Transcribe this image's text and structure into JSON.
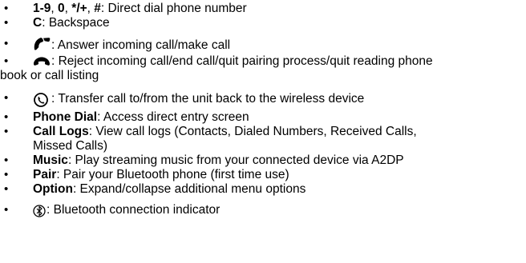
{
  "bullet_char": "•",
  "items": [
    {
      "bold": "1-9",
      "sep1": ", ",
      "bold2": "0",
      "sep2": ", ",
      "bold3": "*/+",
      "sep3": ", ",
      "bold4": "#",
      "text": ": Direct dial phone number"
    },
    {
      "bold": "C",
      "text": ": Backspace"
    },
    {
      "icon": "phone-answer-icon",
      "text": ": Answer incoming call/make call"
    },
    {
      "icon": "phone-hangup-icon",
      "text": ": Reject incoming call/end call/quit pairing process/quit reading phone",
      "cont": "book or call listing"
    },
    {
      "icon": "transfer-call-icon",
      "text": ": Transfer call to/from the unit back to the wireless device"
    },
    {
      "bold": "Phone Dial",
      "text": ": Access direct entry screen"
    },
    {
      "bold": "Call Logs",
      "text": ": View call logs (Contacts, Dialed Numbers, Received Calls,",
      "cont": "Missed Calls)"
    },
    {
      "bold": "Music",
      "text": ": Play streaming music from your connected device via A2DP"
    },
    {
      "bold": "Pair",
      "text": ": Pair your Bluetooth phone (first time use)"
    },
    {
      "bold": "Option",
      "text": ": Expand/collapse additional menu options"
    },
    {
      "icon": "bluetooth-icon",
      "text": ": Bluetooth connection indicator"
    }
  ]
}
